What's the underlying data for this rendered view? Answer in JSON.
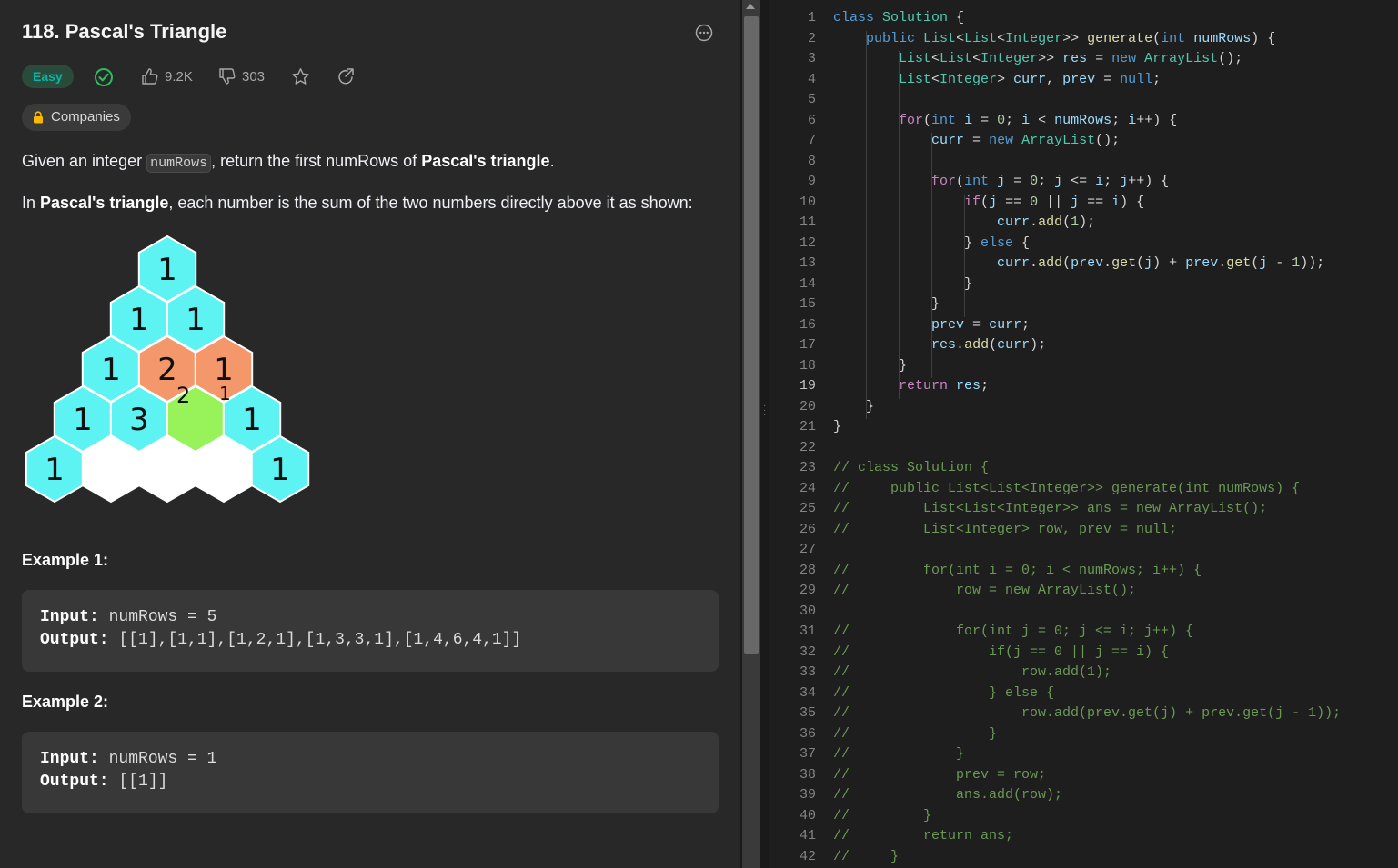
{
  "problem": {
    "title": "118. Pascal's Triangle",
    "difficulty": "Easy",
    "likes": "9.2K",
    "dislikes": "303",
    "companies_label": "Companies",
    "description_1_pre": "Given an integer ",
    "description_1_code": "numRows",
    "description_1_mid": ", return the first numRows of ",
    "description_1_bold": "Pascal's triangle",
    "description_1_end": ".",
    "description_2_pre": "In ",
    "description_2_bold": "Pascal's triangle",
    "description_2_end": ", each number is the sum of the two numbers directly above it as shown:",
    "triangle_rows": [
      [
        "1"
      ],
      [
        "1",
        "1"
      ],
      [
        "1",
        "2",
        "1"
      ],
      [
        "1",
        "3",
        "",
        "1"
      ],
      [
        "1",
        "",
        "",
        "",
        "1"
      ]
    ],
    "triangle_sub_labels": [
      "2",
      "1"
    ],
    "examples": [
      {
        "title": "Example 1:",
        "input_label": "Input:",
        "input": "numRows = 5",
        "output_label": "Output:",
        "output": "[[1],[1,1],[1,2,1],[1,3,3,1],[1,4,6,4,1]]"
      },
      {
        "title": "Example 2:",
        "input_label": "Input:",
        "input": "numRows = 1",
        "output_label": "Output:",
        "output": "[[1]]"
      }
    ]
  },
  "colors": {
    "hex_cyan": "#5ef3f3",
    "hex_orange": "#f4986c",
    "hex_green": "#98f35a",
    "hex_white": "#ffffff",
    "accent_easy": "#00b8a3",
    "check_green": "#2cbb5d"
  },
  "editor": {
    "active_line": 19,
    "line_numbers": [
      "1",
      "2",
      "3",
      "4",
      "5",
      "6",
      "7",
      "8",
      "9",
      "10",
      "11",
      "12",
      "13",
      "14",
      "15",
      "16",
      "17",
      "18",
      "19",
      "20",
      "21",
      "22",
      "23",
      "24",
      "25",
      "26",
      "27",
      "28",
      "29",
      "30",
      "31",
      "32",
      "33",
      "34",
      "35",
      "36",
      "37",
      "38",
      "39",
      "40",
      "41",
      "42"
    ],
    "lines": [
      "class Solution {",
      "    public List<List<Integer>> generate(int numRows) {",
      "        List<List<Integer>> res = new ArrayList();",
      "        List<Integer> curr, prev = null;",
      "",
      "        for(int i = 0; i < numRows; i++) {",
      "            curr = new ArrayList();",
      "",
      "            for(int j = 0; j <= i; j++) {",
      "                if(j == 0 || j == i) {",
      "                    curr.add(1);",
      "                } else {",
      "                    curr.add(prev.get(j) + prev.get(j - 1));",
      "                }",
      "            }",
      "            prev = curr;",
      "            res.add(curr);",
      "        }",
      "        return res;",
      "    }",
      "}",
      "",
      "// class Solution {",
      "//     public List<List<Integer>> generate(int numRows) {",
      "//         List<List<Integer>> ans = new ArrayList();",
      "//         List<Integer> row, prev = null;",
      "",
      "//         for(int i = 0; i < numRows; i++) {",
      "//             row = new ArrayList();",
      "",
      "//             for(int j = 0; j <= i; j++) {",
      "//                 if(j == 0 || j == i) {",
      "//                     row.add(1);",
      "//                 } else {",
      "//                     row.add(prev.get(j) + prev.get(j - 1));",
      "//                 }",
      "//             }",
      "//             prev = row;",
      "//             ans.add(row);",
      "//         }",
      "//         return ans;",
      "//     }"
    ]
  },
  "icons": {
    "more": "more-horizontal-icon",
    "solved": "check-circle-icon",
    "like": "thumbs-up-icon",
    "dislike": "thumbs-down-icon",
    "favorite": "star-icon",
    "share": "share-icon",
    "lock": "lock-icon"
  }
}
